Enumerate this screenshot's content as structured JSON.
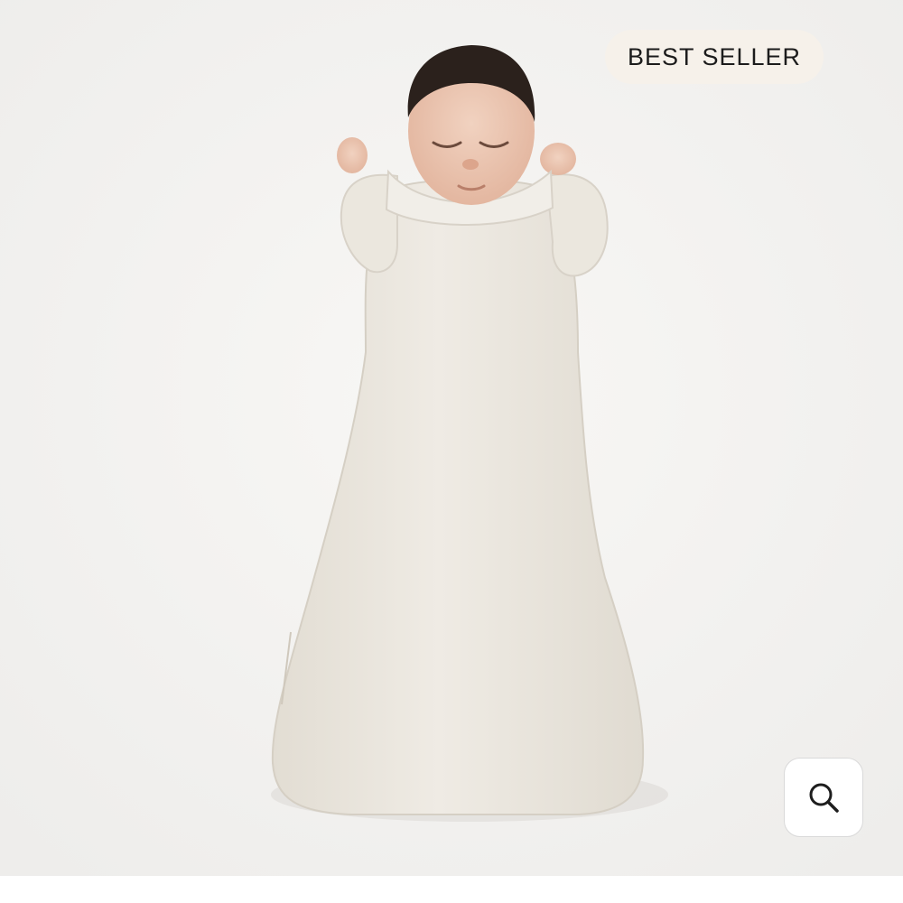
{
  "product": {
    "badge_label": "BEST SELLER",
    "image_description_icon": "product-photo",
    "zoom_icon": "search-icon"
  },
  "colors": {
    "background": "#f3f2f0",
    "sack": "#e9e5dd",
    "badge_bg": "#f6f1ea",
    "badge_text": "#1c1c1c"
  }
}
